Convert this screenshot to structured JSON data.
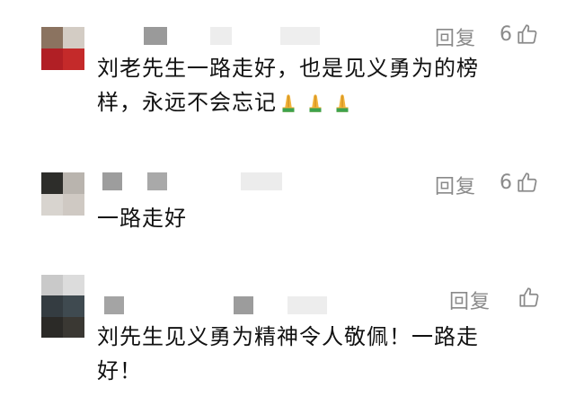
{
  "comments": [
    {
      "reply_label": "回复",
      "like_count": "6",
      "text": "刘老先生一路走好，也是见义勇为的榜样，永远不会忘记",
      "emoji_icon": "folded-hands-icon",
      "emoji_count": 3,
      "avatar_colors": [
        "#8b7360",
        "#c9c0b6",
        "#b11f25",
        "#c42a2a"
      ]
    },
    {
      "reply_label": "回复",
      "like_count": "6",
      "text": "一路走好",
      "avatar_colors": [
        "#2d2d2a",
        "#b9b4ae",
        "#d8d4cf",
        "#cfc9c3"
      ]
    },
    {
      "reply_label": "回复",
      "like_count": "",
      "text": "刘先生见义勇为精神令人敬佩！一路走好！",
      "avatar_colors": [
        "#c9c9c9",
        "#dcdcdc",
        "#343c41",
        "#3f4a50"
      ]
    }
  ],
  "colors": {
    "meta_text": "#8a8a8a",
    "body_text": "#111111"
  }
}
